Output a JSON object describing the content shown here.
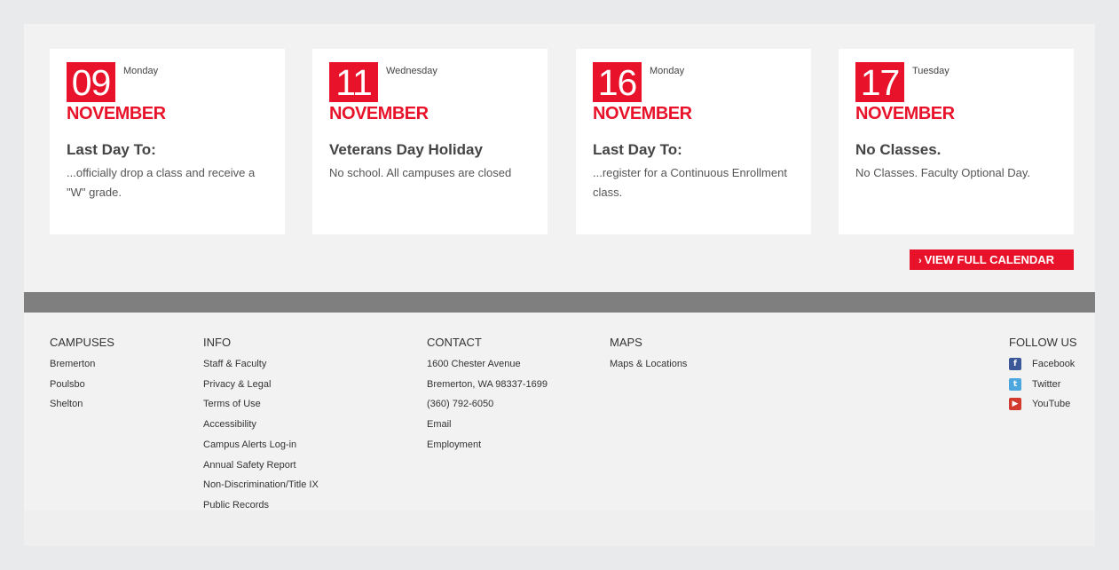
{
  "events": [
    {
      "day": "09",
      "weekday": "Monday",
      "month": "NOVEMBER",
      "title": "Last Day To:",
      "description": "...officially drop a class and receive a \"W\" grade."
    },
    {
      "day": "11",
      "weekday": "Wednesday",
      "month": "NOVEMBER",
      "title": "Veterans Day Holiday",
      "description": "No school. All campuses are closed"
    },
    {
      "day": "16",
      "weekday": "Monday",
      "month": "NOVEMBER",
      "title": "Last Day To:",
      "description": "...register for a Continuous Enrollment class."
    },
    {
      "day": "17",
      "weekday": "Tuesday",
      "month": "NOVEMBER",
      "title": "No Classes.",
      "description": "No Classes. Faculty Optional Day."
    }
  ],
  "calendar_button": {
    "label": "VIEW FULL CALENDAR",
    "icon": "chevron-right-icon"
  },
  "footer": {
    "campuses": {
      "heading": "CAMPUSES",
      "items": [
        "Bremerton",
        "Poulsbo",
        "Shelton"
      ]
    },
    "info": {
      "heading": "INFO",
      "items": [
        "Staff & Faculty",
        "Privacy & Legal",
        "Terms of Use",
        "Accessibility",
        "Campus Alerts Log-in",
        "Annual Safety Report",
        "Non-Discrimination/Title IX",
        "Public Records"
      ]
    },
    "contact": {
      "heading": "CONTACT",
      "address1": "1600 Chester Avenue",
      "address2": "Bremerton, WA 98337-1699",
      "phone": "(360) 792-6050",
      "email": "Email",
      "employment": "Employment"
    },
    "maps": {
      "heading": "MAPS",
      "items": [
        "Maps & Locations"
      ]
    },
    "follow": {
      "heading": "FOLLOW US",
      "items": [
        {
          "label": "Facebook",
          "icon": "facebook-icon",
          "color": "#3b5998"
        },
        {
          "label": "Twitter",
          "icon": "twitter-icon",
          "color": "#4ca7df"
        },
        {
          "label": "YouTube",
          "icon": "youtube-icon",
          "color": "#d23a2e"
        }
      ]
    }
  },
  "colors": {
    "accent": "#e8132a",
    "bar": "#7f7f7f"
  }
}
